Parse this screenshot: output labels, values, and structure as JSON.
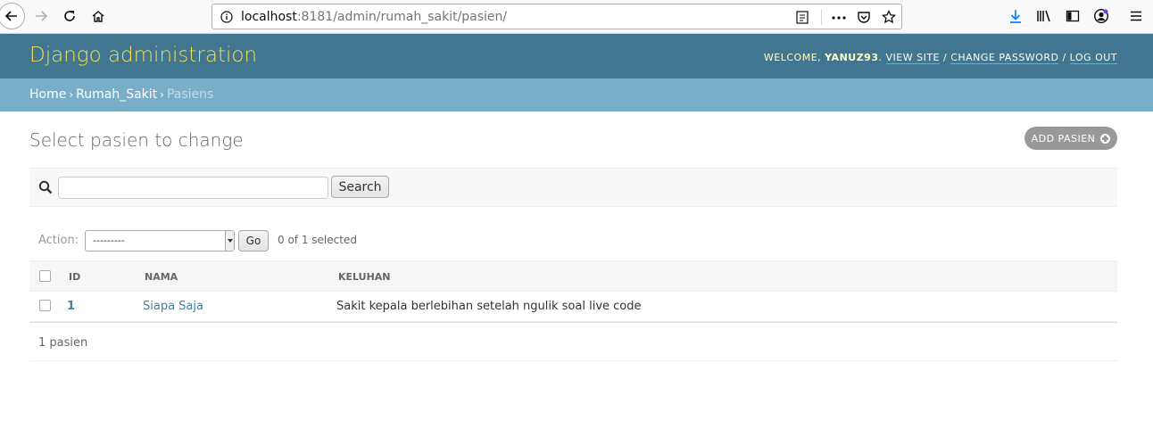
{
  "browser": {
    "url_host": "localhost",
    "url_path": ":8181/admin/rumah_sakit/pasien/"
  },
  "header": {
    "branding": "Django administration",
    "welcome": "Welcome,",
    "username": "yanuz93",
    "view_site": "View site",
    "change_password": "Change password",
    "log_out": "Log out"
  },
  "breadcrumbs": {
    "home": "Home",
    "app": "Rumah_Sakit",
    "current": "Pasiens"
  },
  "content": {
    "title": "Select pasien to change",
    "add_button": "Add pasien",
    "search_button": "Search",
    "search_value": "",
    "action_label": "Action:",
    "action_selected": "---------",
    "go_button": "Go",
    "counter": "0 of 1 selected",
    "columns": [
      "ID",
      "Nama",
      "Keluhan"
    ],
    "rows": [
      {
        "id": "1",
        "nama": "Siapa Saja",
        "keluhan": "Sakit kepala berlebihan setelah ngulik soal live code"
      }
    ],
    "paginator": "1 pasien"
  },
  "colors": {
    "header_bg": "#417690",
    "branding": "#f5dd5d",
    "breadcrumbs_bg": "#79aec8",
    "link": "#447e9b"
  }
}
